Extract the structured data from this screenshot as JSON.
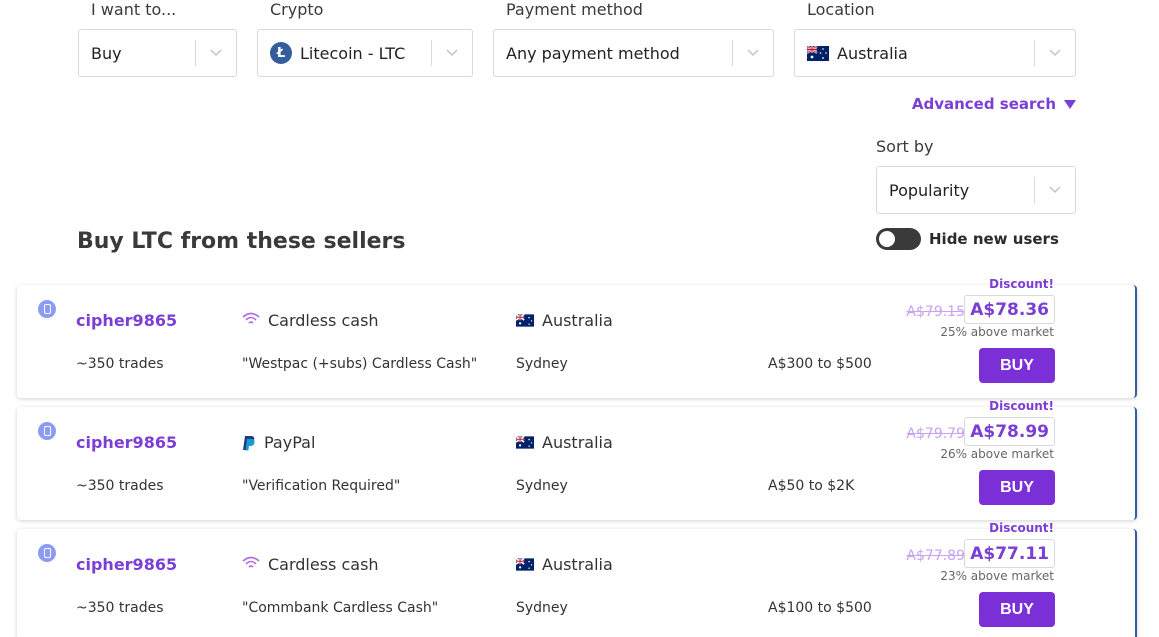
{
  "filters": {
    "want": {
      "label": "I want to...",
      "value": "Buy"
    },
    "crypto": {
      "label": "Crypto",
      "value": "Litecoin - LTC",
      "icon": "litecoin-icon",
      "icon_glyph": "Ł"
    },
    "payment": {
      "label": "Payment method",
      "value": "Any payment method"
    },
    "location": {
      "label": "Location",
      "value": "Australia",
      "icon": "australia-flag-icon"
    }
  },
  "advanced_search": "Advanced search",
  "sort": {
    "label": "Sort by",
    "value": "Popularity"
  },
  "heading": "Buy LTC from these sellers",
  "hide_new_users": {
    "label": "Hide new users",
    "enabled": false
  },
  "colors": {
    "accent": "#7b3fd6",
    "buy_button": "#7b2fd6",
    "old_price": "#c9a3ef",
    "card_edge": "#335e9a"
  },
  "offers": [
    {
      "seller": "cipher9865",
      "trades": "~350 trades",
      "method": "Cardless cash",
      "method_icon": "cardless-cash-icon",
      "description": "\"Westpac (+subs) Cardless Cash\"",
      "country": "Australia",
      "city": "Sydney",
      "limits": "A$300 to $500",
      "discount_label": "Discount!",
      "old_price": "A$79.15",
      "price": "A$78.36",
      "above_market": "25% above market",
      "buy_label": "BUY"
    },
    {
      "seller": "cipher9865",
      "trades": "~350 trades",
      "method": "PayPal",
      "method_icon": "paypal-icon",
      "description": "\"Verification Required\"",
      "country": "Australia",
      "city": "Sydney",
      "limits": "A$50 to $2K",
      "discount_label": "Discount!",
      "old_price": "A$79.79",
      "price": "A$78.99",
      "above_market": "26% above market",
      "buy_label": "BUY"
    },
    {
      "seller": "cipher9865",
      "trades": "~350 trades",
      "method": "Cardless cash",
      "method_icon": "cardless-cash-icon",
      "description": "\"Commbank Cardless Cash\"",
      "country": "Australia",
      "city": "Sydney",
      "limits": "A$100 to $500",
      "discount_label": "Discount!",
      "old_price": "A$77.89",
      "price": "A$77.11",
      "above_market": "23% above market",
      "buy_label": "BUY"
    }
  ]
}
